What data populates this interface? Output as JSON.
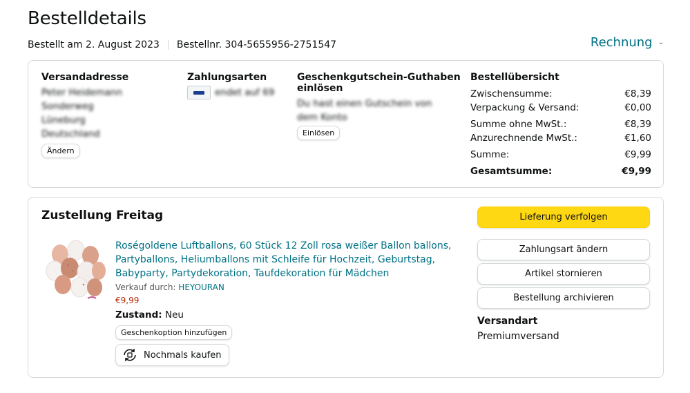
{
  "header": {
    "title": "Bestelldetails",
    "ordered_on": "Bestellt am 2. August 2023",
    "order_number": "Bestellnr. 304-5655956-2751547",
    "invoice_label": "Rechnung"
  },
  "summary_box": {
    "shipping_address": {
      "heading": "Versandadresse",
      "lines": [
        "Peter Heidemann",
        "Sonderweg",
        "Lüneburg",
        "Deutschland"
      ],
      "change_label": "Ändern"
    },
    "payment": {
      "heading": "Zahlungsarten",
      "card_text": "endet auf 69"
    },
    "gift_card": {
      "heading_line1": "Geschenkgutschein-Guthaben",
      "heading_line2": "einlösen",
      "lines": [
        "Du hast einen Gutschein von",
        "dem Konto"
      ],
      "redeem_label": "Einlösen"
    },
    "order_summary": {
      "heading": "Bestellübersicht",
      "rows": [
        {
          "label": "Zwischensumme:",
          "value": "€8,39"
        },
        {
          "label": "Verpackung & Versand:",
          "value": "€0,00"
        },
        {
          "label": "Summe ohne MwSt.:",
          "value": "€8,39"
        },
        {
          "label": "Anzurechnende MwSt.:",
          "value": "€1,60"
        },
        {
          "label": "Summe:",
          "value": "€9,99"
        },
        {
          "label": "Gesamtsumme:",
          "value": "€9,99"
        }
      ]
    }
  },
  "delivery": {
    "title": "Zustellung Freitag",
    "product": {
      "title": "Roségoldene Luftballons, 60 Stück 12 Zoll rosa weißer Ballon ballons, Partyballons, Heliumballons mit Schleife für Hochzeit, Geburtstag, Babyparty, Partydekoration, Taufdekoration für Mädchen",
      "seller_prefix": "Verkauf durch:",
      "seller": "HEYOURAN",
      "price": "€9,99",
      "condition_label": "Zustand:",
      "condition_value": "Neu",
      "gift_option_label": "Geschenkoption hinzufügen",
      "buy_again_label": "Nochmals kaufen"
    },
    "actions": {
      "track": "Lieferung verfolgen",
      "change_payment": "Zahlungsart ändern",
      "cancel": "Artikel stornieren",
      "archive": "Bestellung archivieren"
    },
    "shipping_method_label": "Versandart",
    "shipping_method_value": "Premiumversand"
  },
  "colors": {
    "link": "#007185",
    "primary_button": "#ffd814",
    "price": "#b12704",
    "border": "#d5d9d9"
  }
}
